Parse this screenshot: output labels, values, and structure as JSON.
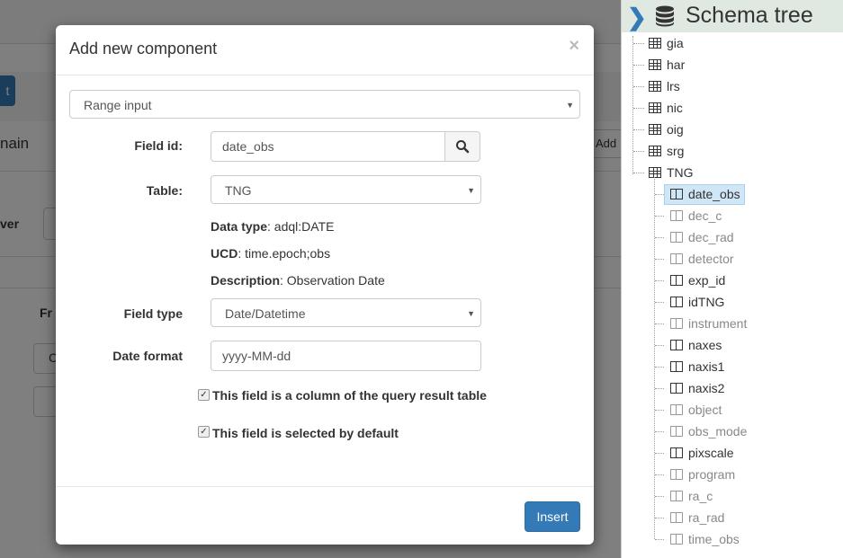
{
  "background": {
    "main_partial": "nain",
    "ver_partial": "ver",
    "fr_partial": "Fr",
    "add_partial": "Add",
    "c_partial": "C",
    "button_partial": "t"
  },
  "modal": {
    "title": "Add new component",
    "close_label": "×",
    "component_type": {
      "value": "Range input"
    },
    "field_id": {
      "label": "Field id:",
      "value": "date_obs"
    },
    "table": {
      "label": "Table:",
      "value": "TNG"
    },
    "data_type": {
      "label": "Data type",
      "value": ": adql:DATE"
    },
    "ucd": {
      "label": "UCD",
      "value": ": time.epoch;obs"
    },
    "description": {
      "label": "Description",
      "value": ": Observation Date"
    },
    "field_type": {
      "label": "Field type",
      "value": "Date/Datetime"
    },
    "date_format": {
      "label": "Date format",
      "value": "yyyy-MM-dd"
    },
    "checkbox_column": {
      "label": "This field is a column of the query result table",
      "checked": true
    },
    "checkbox_selected": {
      "label": "This field is selected by default",
      "checked": true
    },
    "insert_label": "Insert"
  },
  "sidebar": {
    "title": "Schema tree",
    "tables": [
      {
        "name": "gia"
      },
      {
        "name": "har"
      },
      {
        "name": "lrs"
      },
      {
        "name": "nic"
      },
      {
        "name": "oig"
      },
      {
        "name": "srg"
      },
      {
        "name": "TNG"
      }
    ],
    "columns": [
      {
        "name": "date_obs",
        "muted": false,
        "selected": true
      },
      {
        "name": "dec_c",
        "muted": true
      },
      {
        "name": "dec_rad",
        "muted": true
      },
      {
        "name": "detector",
        "muted": true
      },
      {
        "name": "exp_id",
        "muted": false
      },
      {
        "name": "idTNG",
        "muted": false
      },
      {
        "name": "instrument",
        "muted": true
      },
      {
        "name": "naxes",
        "muted": false
      },
      {
        "name": "naxis1",
        "muted": false
      },
      {
        "name": "naxis2",
        "muted": false
      },
      {
        "name": "object",
        "muted": true
      },
      {
        "name": "obs_mode",
        "muted": true
      },
      {
        "name": "pixscale",
        "muted": false
      },
      {
        "name": "program",
        "muted": true
      },
      {
        "name": "ra_c",
        "muted": true
      },
      {
        "name": "ra_rad",
        "muted": true
      },
      {
        "name": "time_obs",
        "muted": true
      }
    ]
  }
}
